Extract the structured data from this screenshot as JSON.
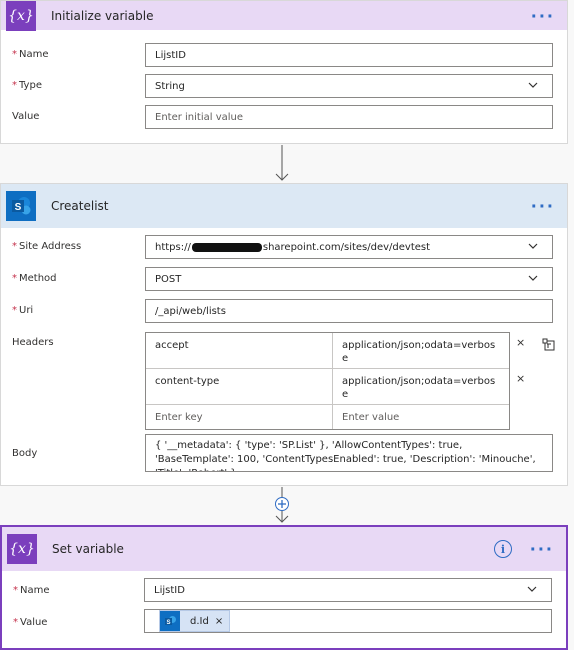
{
  "init_var": {
    "title": "Initialize variable",
    "icon": "{x}",
    "name_label": "Name",
    "name_value": "LijstID",
    "type_label": "Type",
    "type_value": "String",
    "value_label": "Value",
    "value_placeholder": "Enter initial value"
  },
  "createlist": {
    "title": "Createlist",
    "site_label": "Site Address",
    "site_prefix": "https://",
    "site_suffix": "sharepoint.com/sites/dev/devtest",
    "method_label": "Method",
    "method_value": "POST",
    "uri_label": "Uri",
    "uri_value": "/_api/web/lists",
    "headers_label": "Headers",
    "headers": [
      {
        "key": "accept",
        "value": "application/json;odata=verbose"
      },
      {
        "key": "content-type",
        "value": "application/json;odata=verbose"
      }
    ],
    "key_placeholder": "Enter key",
    "value_placeholder": "Enter value",
    "body_label": "Body",
    "body_value": "{ '__metadata': { 'type': 'SP.List' }, 'AllowContentTypes': true, 'BaseTemplate': 100, 'ContentTypesEnabled': true, 'Description': 'Minouche', 'Title': 'Robert' }"
  },
  "set_var": {
    "title": "Set variable",
    "icon": "{x}",
    "name_label": "Name",
    "name_value": "LijstID",
    "value_label": "Value",
    "token_label": "d.Id"
  },
  "common": {
    "more": "···",
    "info": "i",
    "remove": "×"
  },
  "colors": {
    "variable_header": "#e8d9f5",
    "sharepoint_header": "#dce8f4",
    "variable_icon": "#7b3fbd",
    "sharepoint_icon": "#0e6ec2",
    "accent": "#2f6cc4",
    "required": "#c4314b"
  }
}
